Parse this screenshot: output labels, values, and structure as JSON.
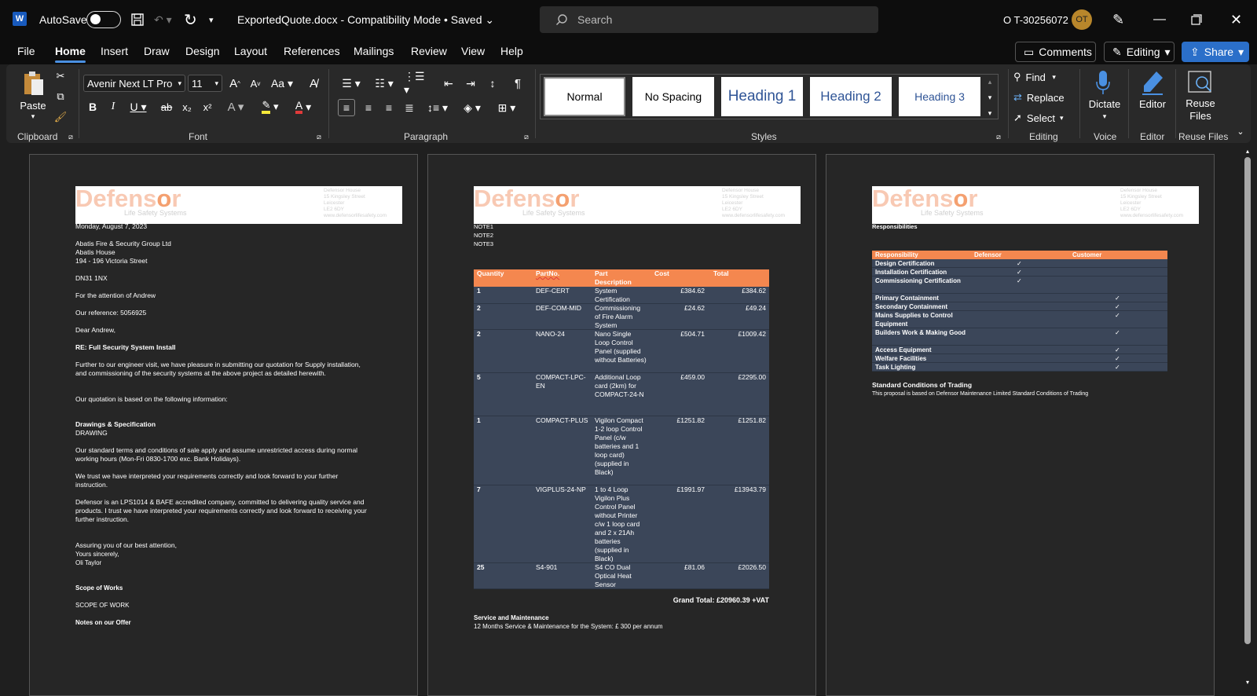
{
  "titlebar": {
    "autosave_label": "AutoSave",
    "doc_title": "ExportedQuote.docx  -  Compatibility Mode • Saved",
    "search_placeholder": "Search",
    "user_name": "O T-30256072",
    "user_initials": "OT"
  },
  "menu": {
    "items": [
      "File",
      "Home",
      "Insert",
      "Draw",
      "Design",
      "Layout",
      "References",
      "Mailings",
      "Review",
      "View",
      "Help"
    ],
    "comments": "Comments",
    "editing": "Editing",
    "share": "Share"
  },
  "ribbon": {
    "paste": "Paste",
    "clipboard_label": "Clipboard",
    "font_name": "Avenir Next LT Pro",
    "font_size": "11",
    "font_label": "Font",
    "paragraph_label": "Paragraph",
    "styles": [
      "Normal",
      "No Spacing",
      "Heading 1",
      "Heading 2",
      "Heading 3"
    ],
    "styles_label": "Styles",
    "find": "Find",
    "replace": "Replace",
    "select": "Select",
    "editing_label": "Editing",
    "dictate": "Dictate",
    "voice_label": "Voice",
    "editor": "Editor",
    "editor_label": "Editor",
    "reuse_files": "Reuse Files",
    "reuse_label": "Reuse Files"
  },
  "logo": {
    "name": "Defensor",
    "tagline": "Life Safety Systems",
    "addr1": "Defensor House",
    "addr2": "15 Kingsley Street",
    "addr3": "Leicester",
    "addr4": "LE2 6DY",
    "web": "www.defensorlifesafety.com"
  },
  "page1": {
    "date": "Monday, August 7, 2023",
    "company": "Abatis Fire & Security Group Ltd",
    "house": "Abatis House",
    "street": "194 - 196 Victoria Street",
    "postcode": "DN31 1NX",
    "attention": "For the attention of Andrew",
    "reference": "Our reference: 5056925",
    "dear": "Dear Andrew,",
    "re": "RE: Full Security System Install",
    "para1": "Further to our engineer visit, we have pleasure in submitting our quotation for Supply installation, and commissioning of the security systems at the above project as detailed herewith.",
    "para2": "Our quotation is based on the following information:",
    "drawings_heading": "Drawings & Specification",
    "drawing": "DRAWING",
    "para3": "Our standard terms and conditions of sale apply and assume unrestricted access during normal working hours (Mon-Fri 0830-1700 exc. Bank Holidays).",
    "para4": "We trust we have interpreted your requirements correctly and look forward to your further instruction.",
    "para5": "Defensor is an LPS1014 & BAFE accredited company, committed to delivering quality service and products. I trust we have interpreted your requirements correctly and look forward to receiving your further instruction.",
    "assuring": "Assuring you of our best attention,",
    "yours": "Yours sincerely,",
    "signer": "Oli Taylor",
    "scope_heading": "Scope of Works",
    "scope": "SCOPE OF WORK",
    "notes": "Notes on our Offer"
  },
  "page2": {
    "notes": [
      "NOTE1",
      "NOTE2",
      "NOTE3"
    ],
    "headers": [
      "Quantity",
      "PartNo.",
      "Part Description",
      "Cost",
      "Total"
    ],
    "rows": [
      {
        "qty": "1",
        "part": "DEF-CERT",
        "desc": "System Certification",
        "cost": "£384.62",
        "total": "£384.62"
      },
      {
        "qty": "2",
        "part": "DEF-COM-MID",
        "desc": "Commissioning of Fire Alarm System",
        "cost": "£24.62",
        "total": "£49.24"
      },
      {
        "qty": "2",
        "part": "NANO-24",
        "desc": "Nano Single Loop Control Panel (supplied without Batteries)",
        "cost": "£504.71",
        "total": "£1009.42"
      },
      {
        "qty": "5",
        "part": "COMPACT-LPC-EN",
        "desc": "Additional Loop card (2km) for COMPACT-24-N",
        "cost": "£459.00",
        "total": "£2295.00"
      },
      {
        "qty": "1",
        "part": "COMPACT-PLUS",
        "desc": "Vigilon Compact 1-2 loop Control Panel (c/w batteries and 1 loop card) (supplied in Black)",
        "cost": "£1251.82",
        "total": "£1251.82"
      },
      {
        "qty": "7",
        "part": "VIGPLUS-24-NP",
        "desc": "1 to 4 Loop Vigilon Plus Control Panel without Printer c/w 1 loop card and 2 x 21Ah batteries (supplied in Black)",
        "cost": "£1991.97",
        "total": "£13943.79"
      },
      {
        "qty": "25",
        "part": "S4-901",
        "desc": "S4 CO Dual Optical Heat Sensor",
        "cost": "£81.06",
        "total": "£2026.50"
      }
    ],
    "grand_total": "Grand Total: £20960.39 +VAT",
    "service_heading": "Service and Maintenance",
    "service_text": "12 Months Service & Maintenance for the System: £ 300 per annum"
  },
  "page3": {
    "heading": "Responsibilities",
    "headers": [
      "Responsibility",
      "Defensor",
      "Customer"
    ],
    "rows": [
      {
        "name": "Design Certification",
        "defensor": "✓",
        "customer": ""
      },
      {
        "name": "Installation Certification",
        "defensor": "✓",
        "customer": ""
      },
      {
        "name": "Commissioning Certification",
        "defensor": "✓",
        "customer": ""
      },
      {
        "name": "Primary Containment",
        "defensor": "",
        "customer": "✓"
      },
      {
        "name": "Secondary Containment",
        "defensor": "",
        "customer": "✓"
      },
      {
        "name": "Mains Supplies to Control Equipment",
        "defensor": "",
        "customer": "✓"
      },
      {
        "name": "Builders Work & Making Good",
        "defensor": "",
        "customer": "✓"
      },
      {
        "name": "Access Equipment",
        "defensor": "",
        "customer": "✓"
      },
      {
        "name": "Welfare Facilities",
        "defensor": "",
        "customer": "✓"
      },
      {
        "name": "Task Lighting",
        "defensor": "",
        "customer": "✓"
      }
    ],
    "conditions_heading": "Standard Conditions of Trading",
    "conditions_text": "This proposal is based on Defensor Maintenance Limited Standard Conditions of Trading"
  },
  "colors": {
    "accent": "#4a90e2",
    "table_header": "#f4874f",
    "table_row": "#3b4659",
    "share": "#2b6fc9"
  }
}
